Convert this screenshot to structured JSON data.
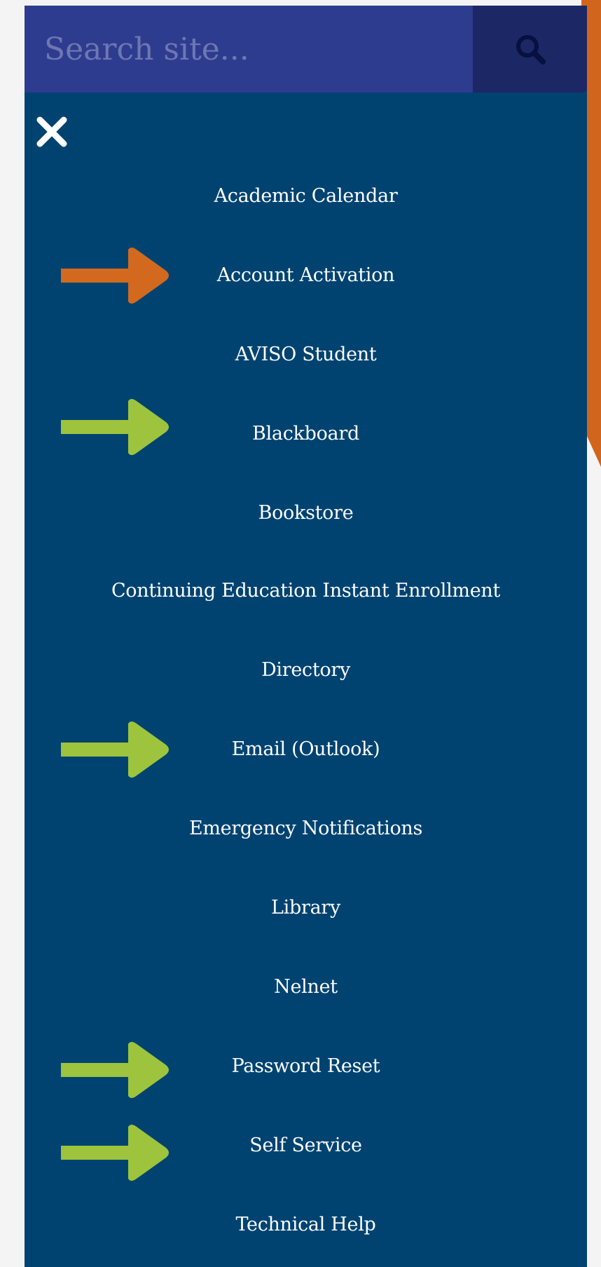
{
  "search": {
    "placeholder": "Search site...",
    "icon": "search-icon"
  },
  "close": {
    "icon": "close-icon"
  },
  "menu": {
    "items": [
      {
        "label": "Academic Calendar"
      },
      {
        "label": "Account Activation"
      },
      {
        "label": "AVISO Student"
      },
      {
        "label": "Blackboard"
      },
      {
        "label": "Bookstore"
      },
      {
        "label": "Continuing Education Instant Enrollment"
      },
      {
        "label": "Directory"
      },
      {
        "label": "Email (Outlook)"
      },
      {
        "label": "Emergency Notifications"
      },
      {
        "label": "Library"
      },
      {
        "label": "Nelnet"
      },
      {
        "label": "Password Reset"
      },
      {
        "label": "Self Service"
      },
      {
        "label": "Technical Help"
      }
    ]
  },
  "annotations": {
    "colors": {
      "orange": "#d2691e",
      "green": "#9dc43c"
    }
  }
}
